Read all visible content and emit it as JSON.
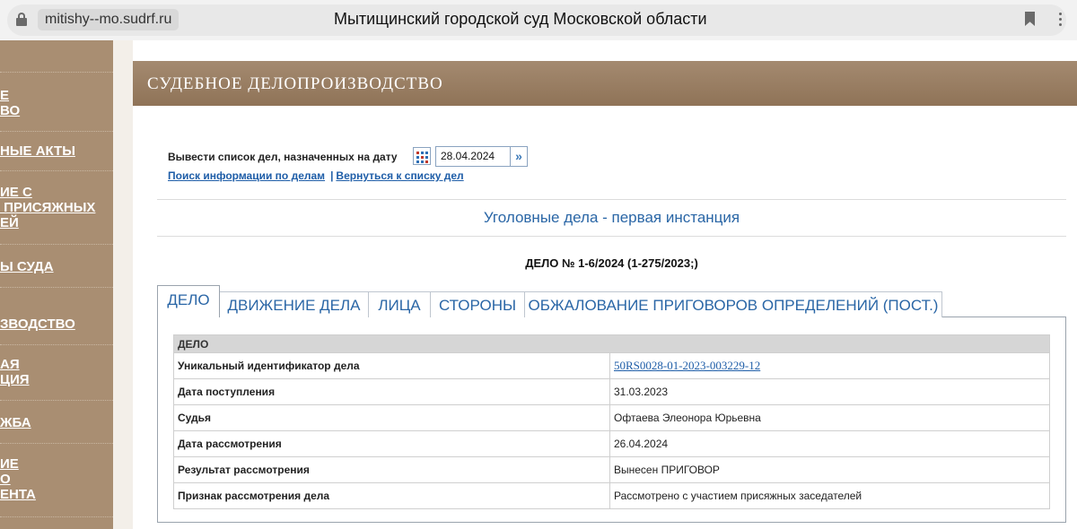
{
  "browser": {
    "domain": "mitishy--mo.sudrf.ru",
    "title": "Мытищинский городской суд Московской области"
  },
  "sidebar": {
    "items": [
      {
        "label": "Е\nВО"
      },
      {
        "label": "НЫЕ АКТЫ"
      },
      {
        "label": "ИЕ С\n ПРИСЯЖНЫХ\nЕЙ"
      },
      {
        "label": "Ы СУДА"
      },
      {
        "label": "ЗВОДСТВО"
      },
      {
        "label": "АЯ\nЦИЯ"
      },
      {
        "label": "ЖБА"
      },
      {
        "label": "ИЕ\nО\nЕНТА"
      }
    ]
  },
  "header": {
    "title": "СУДЕБНОЕ ДЕЛОПРОИЗВОДСТВО"
  },
  "date_filter": {
    "label": "Вывести список дел, назначенных на дату",
    "value": "28.04.2024"
  },
  "links": {
    "search": "Поиск информации по делам",
    "separator": "|",
    "back": "Вернуться к списку дел"
  },
  "section_title": "Уголовные дела - первая инстанция",
  "case_title": "ДЕЛО № 1-6/2024 (1-275/2023;)",
  "tabs": [
    {
      "label": "ДЕЛО",
      "active": true
    },
    {
      "label": "ДВИЖЕНИЕ ДЕЛА",
      "active": false
    },
    {
      "label": "ЛИЦА",
      "active": false
    },
    {
      "label": "СТОРОНЫ",
      "active": false
    },
    {
      "label": "ОБЖАЛОВАНИЕ ПРИГОВОРОВ ОПРЕДЕЛЕНИЙ (ПОСТ.)",
      "active": false
    }
  ],
  "table": {
    "header": "ДЕЛО",
    "rows": [
      {
        "key": "Уникальный идентификатор дела",
        "value": "50RS0028-01-2023-003229-12"
      },
      {
        "key": "Дата поступления",
        "value": "31.03.2023"
      },
      {
        "key": "Судья",
        "value": "Офтаева Элеонора Юрьевна"
      },
      {
        "key": "Дата рассмотрения",
        "value": "26.04.2024"
      },
      {
        "key": "Результат рассмотрения",
        "value": "Вынесен ПРИГОВОР"
      },
      {
        "key": "Признак рассмотрения дела",
        "value": "Рассмотрено с участием присяжных заседателей"
      }
    ]
  },
  "colors": {
    "sidebar": "#a98e72",
    "header": "#967a5e",
    "link": "#1f5ea8",
    "tab_text": "#2a66a6"
  }
}
